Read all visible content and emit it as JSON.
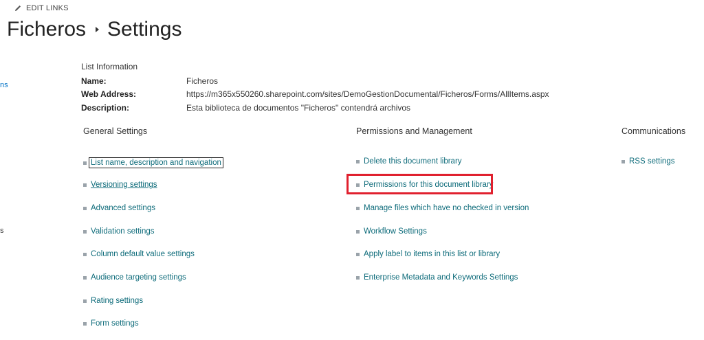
{
  "header": {
    "edit_links": "EDIT LINKS",
    "breadcrumb_root": "Ficheros",
    "breadcrumb_current": "Settings"
  },
  "left_nav_fragments": [
    "ns",
    "s"
  ],
  "list_info": {
    "heading": "List Information",
    "rows": [
      {
        "label": "Name:",
        "value": "Ficheros"
      },
      {
        "label": "Web Address:",
        "value": "https://m365x550260.sharepoint.com/sites/DemoGestionDocumental/Ficheros/Forms/AllItems.aspx"
      },
      {
        "label": "Description:",
        "value": "Esta biblioteca de documentos \"Ficheros\" contendrá archivos"
      }
    ]
  },
  "general": {
    "title": "General Settings",
    "links": [
      "List name, description and navigation",
      "Versioning settings",
      "Advanced settings",
      "Validation settings",
      "Column default value settings",
      "Audience targeting settings",
      "Rating settings",
      "Form settings"
    ]
  },
  "permissions": {
    "title": "Permissions and Management",
    "links": [
      "Delete this document library",
      "Permissions for this document library",
      "Manage files which have no checked in version",
      "Workflow Settings",
      "Apply label to items in this list or library",
      "Enterprise Metadata and Keywords Settings"
    ]
  },
  "communications": {
    "title": "Communications",
    "links": [
      "RSS settings"
    ]
  },
  "colors": {
    "link": "#0d6b7a",
    "highlight": "#e0202e"
  }
}
